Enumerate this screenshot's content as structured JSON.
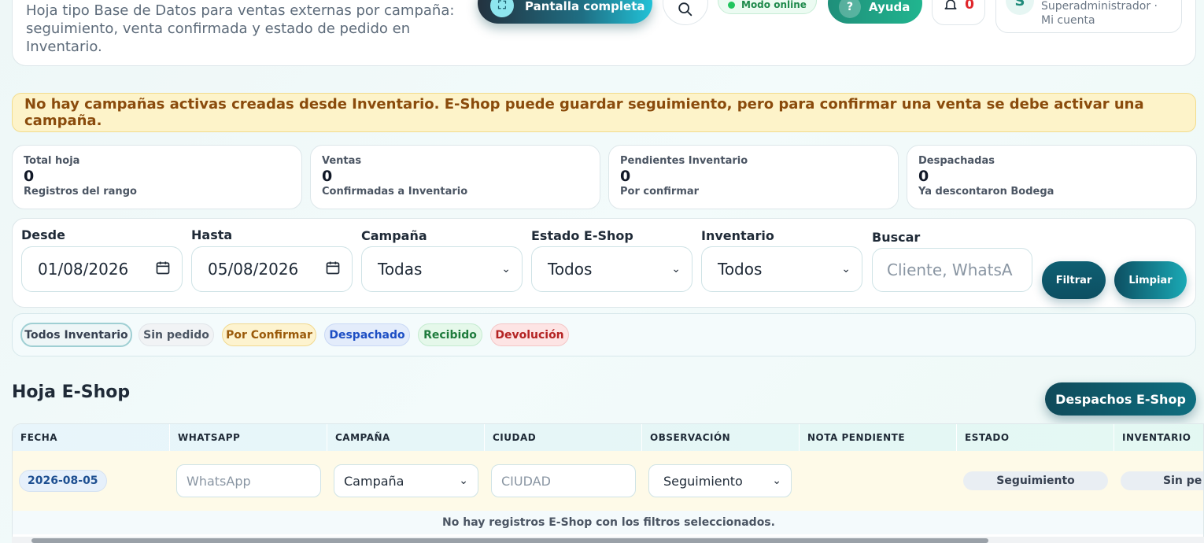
{
  "header": {
    "subtitle": "Hoja tipo Base de Datos para ventas externas por campaña: seguimiento, venta confirmada y estado de pedido en Inventario.",
    "fullscreen_label": "Pantalla completa",
    "online_label": "Modo online",
    "help_label": "Ayuda",
    "notifications_count": "0",
    "account_initial": "S",
    "account_role": "Superadministrador ·",
    "account_link": "Mi cuenta"
  },
  "warning": "No hay campañas activas creadas desde Inventario. E-Shop puede guardar seguimiento, pero para confirmar una venta se debe activar una campaña.",
  "stats": [
    {
      "title": "Total hoja",
      "value": "0",
      "sub": "Registros del rango"
    },
    {
      "title": "Ventas",
      "value": "0",
      "sub": "Confirmadas a Inventario"
    },
    {
      "title": "Pendientes Inventario",
      "value": "0",
      "sub": "Por confirmar"
    },
    {
      "title": "Despachadas",
      "value": "0",
      "sub": "Ya descontaron Bodega"
    }
  ],
  "filters": {
    "desde_label": "Desde",
    "desde_value": "01/08/2026",
    "hasta_label": "Hasta",
    "hasta_value": "05/08/2026",
    "campana_label": "Campaña",
    "campana_value": "Todas",
    "estado_label": "Estado E-Shop",
    "estado_value": "Todos",
    "inventario_label": "Inventario",
    "inventario_value": "Todos",
    "buscar_label": "Buscar",
    "buscar_placeholder": "Cliente, WhatsA",
    "filter_button": "Filtrar",
    "clear_button": "Limpiar"
  },
  "chips": [
    {
      "label": "Todos Inventario",
      "color": "#374151"
    },
    {
      "label": "Sin pedido",
      "color": "#4b5563"
    },
    {
      "label": "Por Confirmar",
      "color": "#9a5a0a"
    },
    {
      "label": "Despachado",
      "color": "#1d4fc4"
    },
    {
      "label": "Recibido",
      "color": "#1e7b3c"
    },
    {
      "label": "Devolución",
      "color": "#b42323"
    }
  ],
  "section": {
    "title": "Hoja E-Shop",
    "dispatch_button": "Despachos E-Shop"
  },
  "table": {
    "columns": [
      "FECHA",
      "WHATSAPP",
      "CAMPAÑA",
      "CIUDAD",
      "OBSERVACIÓN",
      "NOTA PENDIENTE",
      "ESTADO",
      "INVENTARIO"
    ],
    "new_row": {
      "date": "2026-08-05",
      "whatsapp_placeholder": "WhatsApp",
      "campana_value": "Campaña",
      "ciudad_placeholder": "CIUDAD",
      "observacion_value": "Seguimiento",
      "estado": "Seguimiento",
      "inventario": "Sin pe"
    },
    "empty_message": "No hay registros E-Shop con los filtros seleccionados."
  }
}
